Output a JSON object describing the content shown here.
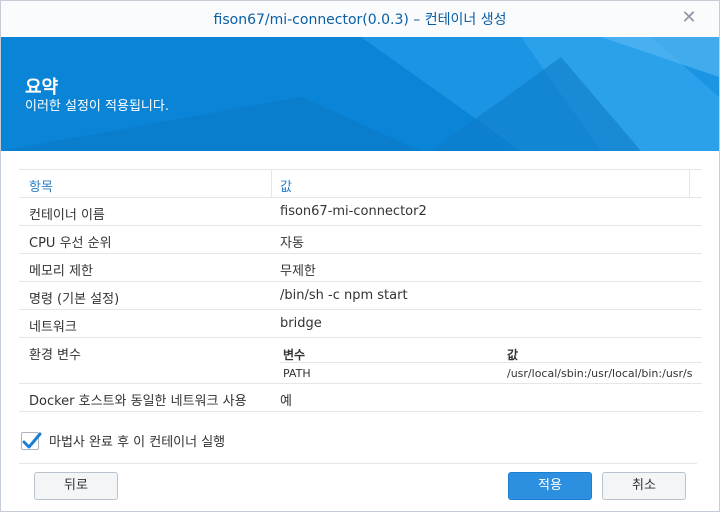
{
  "window": {
    "title": "fison67/mi-connector(0.0.3) – 컨테이너 생성",
    "close_icon": "close-icon"
  },
  "banner": {
    "title": "요약",
    "subtitle": "이러한 설정이 적용됩니다."
  },
  "table": {
    "headers": {
      "item": "항목",
      "value": "값"
    },
    "rows": [
      {
        "item": "컨테이너 이름",
        "value": "fison67-mi-connector2"
      },
      {
        "item": "CPU 우선 순위",
        "value": "자동"
      },
      {
        "item": "메모리 제한",
        "value": "무제한"
      },
      {
        "item": "명령 (기본 설정)",
        "value": "/bin/sh -c npm start"
      },
      {
        "item": "네트워크",
        "value": "bridge"
      }
    ],
    "env": {
      "label": "환경 변수",
      "var_header": "변수",
      "val_header": "값",
      "var": "PATH",
      "val": "/usr/local/sbin:/usr/local/bin:/usr/s"
    },
    "last_row": {
      "item": "Docker 호스트와 동일한 네트워크 사용",
      "value": "예"
    }
  },
  "run_after": {
    "label": "마법사 완료 후 이 컨테이너 실행",
    "checked": true
  },
  "buttons": {
    "back": "뒤로",
    "apply": "적용",
    "cancel": "취소"
  },
  "colors": {
    "accent": "#0a84d6",
    "link": "#2c7fca",
    "primary_button": "#2d8fe0"
  }
}
